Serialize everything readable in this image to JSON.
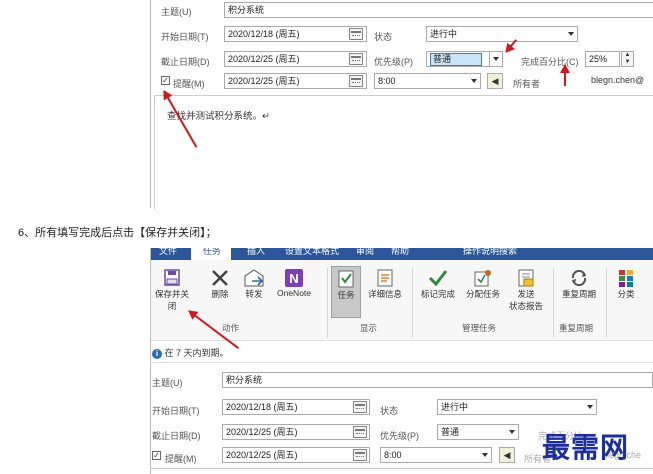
{
  "upper_form": {
    "subject_label": "主题(U)",
    "subject_value": "积分系统",
    "start_label": "开始日期(T)",
    "start_value": "2020/12/18 (周五)",
    "due_label": "截止日期(D)",
    "due_value": "2020/12/25 (周五)",
    "status_label": "状态",
    "status_value": "进行中",
    "priority_label": "优先级(P)",
    "priority_value": "普通",
    "percent_label": "完成百分比(C)",
    "percent_value": "25%",
    "reminder_label": "提醒(M)",
    "reminder_date": "2020/12/25 (周五)",
    "reminder_time": "8:00",
    "owner_label": "所有者",
    "owner_value": "blegn.chen@",
    "body_text": "查找并测试积分系统。↵"
  },
  "instruction": "6、所有填写完成后点击【保存并关闭】；",
  "ribbon": {
    "tabs": [
      "文件",
      "任务",
      "插入",
      "设置文本格式",
      "审阅",
      "帮助",
      "操作说明搜索"
    ],
    "buttons": {
      "save_close": "保存并关闭",
      "delete": "删除",
      "forward": "转发",
      "onenote": "OneNote",
      "task": "任务",
      "details": "详细信息",
      "mark_complete": "标记完成",
      "assign_task": "分配任务",
      "send_report_1": "发送",
      "send_report_2": "状态报告",
      "recurrence": "重复周期",
      "categorize": "分类"
    },
    "groups": {
      "actions": "动作",
      "show": "显示",
      "manage": "管理任务",
      "recurrence": "重复周期"
    }
  },
  "lower_form": {
    "due_notice": "在 7 天内到期。",
    "subject_label": "主题(U)",
    "subject_value": "积分系统",
    "start_label": "开始日期(T)",
    "start_value": "2020/12/18 (周五)",
    "due_label": "截止日期(D)",
    "due_value": "2020/12/25 (周五)",
    "status_label": "状态",
    "status_value": "进行中",
    "priority_label": "优先级(P)",
    "priority_value": "普通",
    "percent_label": "完成百分比",
    "reminder_label": "提醒(M)",
    "reminder_date": "2020/12/25 (周五)",
    "reminder_time": "8:00",
    "owner_label": "所有者",
    "owner_value": "blegn.che"
  },
  "watermark": "最需网",
  "colors": {
    "ribbon_tab_bar": "#2b579a",
    "arrow": "#d4161f",
    "highlight": "#cce4f7",
    "watermark": "#1a2e9e"
  }
}
